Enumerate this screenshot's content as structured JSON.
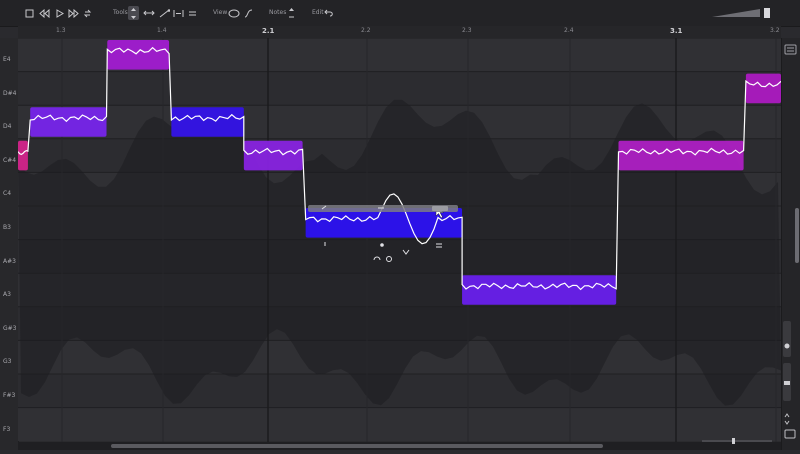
{
  "toolbar": {
    "tool_label": "Tools",
    "view_label": "View",
    "notes_label": "Notes",
    "edit_label": "Edit"
  },
  "ruler": [
    {
      "label": "1.3",
      "major": false
    },
    {
      "label": "1.4",
      "major": false
    },
    {
      "label": "2.1",
      "major": true
    },
    {
      "label": "2.2",
      "major": false
    },
    {
      "label": "2.3",
      "major": false
    },
    {
      "label": "2.4",
      "major": false
    },
    {
      "label": "3.1",
      "major": true
    },
    {
      "label": "3.2",
      "major": false
    }
  ],
  "pitches": [
    "E4",
    "D#4",
    "D4",
    "C#4",
    "C4",
    "B3",
    "A#3",
    "A3",
    "G#3",
    "G3",
    "F#3",
    "F3"
  ],
  "notes": [
    {
      "pitch": "C#4",
      "start": 0.0,
      "end": 0.013,
      "color": "#d8248e"
    },
    {
      "pitch": "D4",
      "start": 0.016,
      "end": 0.116,
      "color": "#7a25f0"
    },
    {
      "pitch": "E4",
      "start": 0.117,
      "end": 0.198,
      "color": "#a61cd6"
    },
    {
      "pitch": "D4",
      "start": 0.201,
      "end": 0.296,
      "color": "#3412ee"
    },
    {
      "pitch": "C#4",
      "start": 0.296,
      "end": 0.373,
      "color": "#8b23e6"
    },
    {
      "pitch": "B3",
      "start": 0.377,
      "end": 0.582,
      "color": "#2c10f8"
    },
    {
      "pitch": "A3",
      "start": 0.582,
      "end": 0.784,
      "color": "#6a1ef2"
    },
    {
      "pitch": "C#4",
      "start": 0.787,
      "end": 0.951,
      "color": "#b220c8"
    },
    {
      "pitch": "D#4",
      "start": 0.954,
      "end": 1.0,
      "color": "#b01ac6"
    }
  ],
  "colors": {
    "accent": "#8a2be2",
    "pitch_curve": "#ffffff"
  },
  "icons": {
    "toolbar": [
      "stop-icon",
      "rewind-icon",
      "play-icon",
      "fast-forward-icon",
      "loop-icon",
      "line-icon",
      "pointer-icon",
      "stretch-icon",
      "pitch-tool-icon",
      "formant-icon",
      "equal-icon",
      "view-blobs-icon",
      "view-curve-icon",
      "notes-icon",
      "undo-icon"
    ]
  }
}
